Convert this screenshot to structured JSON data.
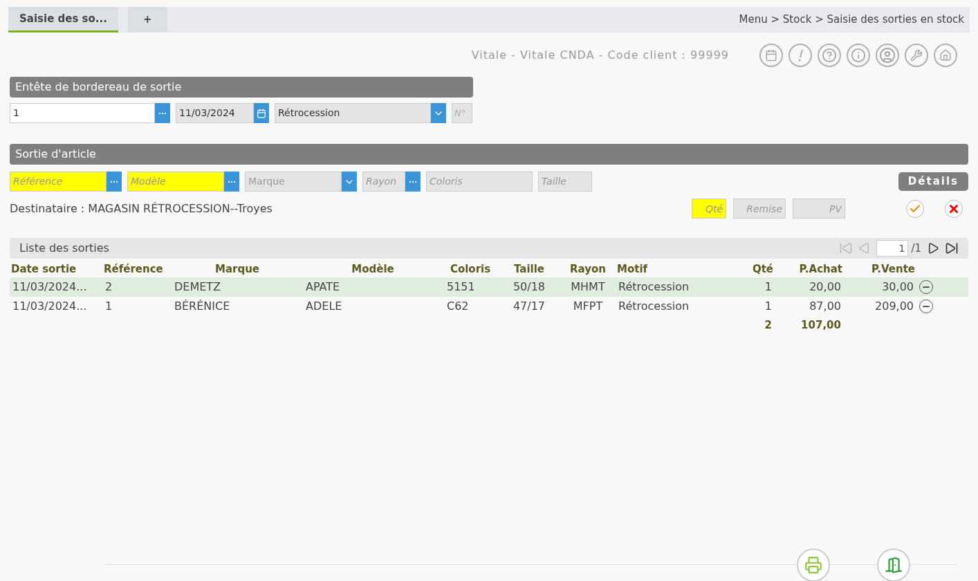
{
  "tabs": [
    {
      "label": "Saisie des so...",
      "selected": true
    },
    {
      "label": "+",
      "selected": false
    }
  ],
  "breadcrumb": "Menu > Stock > Saisie des sorties en stock",
  "client_info": "Vitale - Vitale CNDA - Code client : 99999",
  "header_section": {
    "title": "Entête de bordereau de sortie",
    "number": {
      "value": "1"
    },
    "date": {
      "value": "11/03/2024"
    },
    "motif": {
      "value": "Rétrocession"
    },
    "no": {
      "placeholder": "N°"
    }
  },
  "article_section": {
    "title": "Sortie d'article",
    "details_button": "Détails",
    "fields": [
      {
        "kind": "lookup",
        "placeholder": "Référence",
        "required": true
      },
      {
        "kind": "lookup",
        "placeholder": "Modèle",
        "required": true
      },
      {
        "kind": "select",
        "placeholder": "Marque",
        "required": false
      },
      {
        "kind": "lookup",
        "placeholder": "Rayon",
        "required": false
      },
      {
        "kind": "text",
        "placeholder": "Coloris",
        "required": false
      },
      {
        "kind": "text",
        "placeholder": "Taille",
        "required": false
      }
    ],
    "recipient": "Destinataire : MAGASIN RÉTROCESSION--Troyes",
    "amount_fields": [
      {
        "placeholder": "Qté",
        "required": true
      },
      {
        "placeholder": "Remise",
        "required": false
      },
      {
        "placeholder": "PV",
        "required": false
      }
    ]
  },
  "list": {
    "title": "Liste des sorties",
    "page": "1",
    "page_total": "/1",
    "columns": [
      "Date sortie",
      "Référence",
      "Marque",
      "Modèle",
      "Coloris",
      "Taille",
      "Rayon",
      "Motif",
      "Qté",
      "P.Achat",
      "P.Vente"
    ],
    "rows": [
      {
        "selected": true,
        "cells": [
          "11/03/2024...",
          "2",
          "DEMETZ",
          "APATE",
          "5151",
          "50/18",
          "MHMT",
          "Rétrocession",
          "1",
          "20,00",
          "30,00"
        ]
      },
      {
        "selected": false,
        "cells": [
          "11/03/2024...",
          "1",
          "BÉRÉNICE",
          "ADELE",
          "C62",
          "47/17",
          "MFPT",
          "Rétrocession",
          "1",
          "87,00",
          "209,00"
        ]
      }
    ],
    "totals": {
      "qty": "2",
      "purchase": "107,00"
    }
  }
}
